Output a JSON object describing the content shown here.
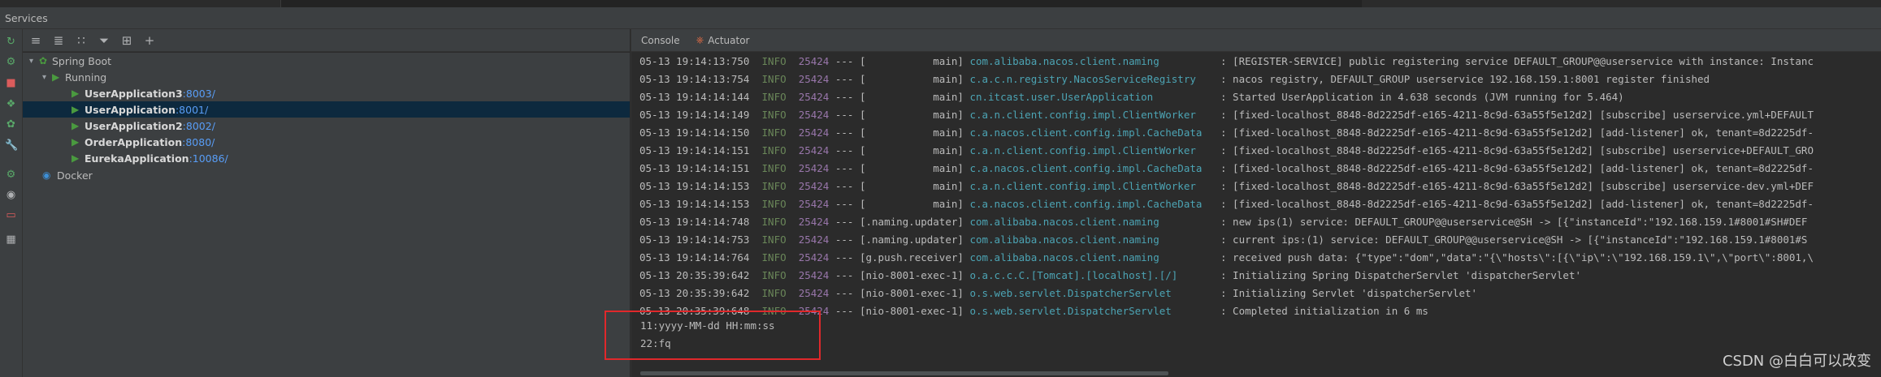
{
  "window": {
    "title": "Services"
  },
  "tree_toolbar": {
    "icons": [
      "expand-all-icon",
      "collapse-all-icon",
      "group-by-icon",
      "filter-icon",
      "new-tab-icon",
      "add-service-icon"
    ]
  },
  "left_toolbar": {
    "icons": [
      "rerun-icon",
      "debug-icon",
      "stop-icon",
      "deploy-icon",
      "spring-icon",
      "settings-icon",
      "restore-icon",
      "screenshot-icon",
      "exit-icon",
      "layout-icon"
    ]
  },
  "tree": {
    "spring_boot": "Spring Boot",
    "running": "Running",
    "apps": [
      {
        "name": "UserApplication3",
        "port": ":8003/"
      },
      {
        "name": "UserApplication",
        "port": ":8001/"
      },
      {
        "name": "UserApplication2",
        "port": ":8002/"
      },
      {
        "name": "OrderApplication",
        "port": ":8080/"
      },
      {
        "name": "EurekaApplication",
        "port": ":10086/"
      }
    ],
    "docker": "Docker"
  },
  "tabs": {
    "console": "Console",
    "actuator": "Actuator"
  },
  "log": [
    {
      "ts": "05-13 19:14:13:750",
      "lvl": "INFO",
      "pid": "25424",
      "sep": " --- [           main] ",
      "logger": "com.alibaba.nacos.client.naming         ",
      "msg": " : [REGISTER-SERVICE] public registering service DEFAULT_GROUP@@userservice with instance: Instanc"
    },
    {
      "ts": "05-13 19:14:13:754",
      "lvl": "INFO",
      "pid": "25424",
      "sep": " --- [           main] ",
      "logger": "c.a.c.n.registry.NacosServiceRegistry   ",
      "msg": " : nacos registry, DEFAULT_GROUP userservice 192.168.159.1:8001 register finished"
    },
    {
      "ts": "05-13 19:14:14:144",
      "lvl": "INFO",
      "pid": "25424",
      "sep": " --- [           main] ",
      "logger": "cn.itcast.user.UserApplication          ",
      "msg": " : Started UserApplication in 4.638 seconds (JVM running for 5.464)"
    },
    {
      "ts": "05-13 19:14:14:149",
      "lvl": "INFO",
      "pid": "25424",
      "sep": " --- [           main] ",
      "logger": "c.a.n.client.config.impl.ClientWorker   ",
      "msg": " : [fixed-localhost_8848-8d2225df-e165-4211-8c9d-63a55f5e12d2] [subscribe] userservice.yml+DEFAULT"
    },
    {
      "ts": "05-13 19:14:14:150",
      "lvl": "INFO",
      "pid": "25424",
      "sep": " --- [           main] ",
      "logger": "c.a.nacos.client.config.impl.CacheData  ",
      "msg": " : [fixed-localhost_8848-8d2225df-e165-4211-8c9d-63a55f5e12d2] [add-listener] ok, tenant=8d2225df-"
    },
    {
      "ts": "05-13 19:14:14:151",
      "lvl": "INFO",
      "pid": "25424",
      "sep": " --- [           main] ",
      "logger": "c.a.n.client.config.impl.ClientWorker   ",
      "msg": " : [fixed-localhost_8848-8d2225df-e165-4211-8c9d-63a55f5e12d2] [subscribe] userservice+DEFAULT_GRO"
    },
    {
      "ts": "05-13 19:14:14:151",
      "lvl": "INFO",
      "pid": "25424",
      "sep": " --- [           main] ",
      "logger": "c.a.nacos.client.config.impl.CacheData  ",
      "msg": " : [fixed-localhost_8848-8d2225df-e165-4211-8c9d-63a55f5e12d2] [add-listener] ok, tenant=8d2225df-"
    },
    {
      "ts": "05-13 19:14:14:153",
      "lvl": "INFO",
      "pid": "25424",
      "sep": " --- [           main] ",
      "logger": "c.a.n.client.config.impl.ClientWorker   ",
      "msg": " : [fixed-localhost_8848-8d2225df-e165-4211-8c9d-63a55f5e12d2] [subscribe] userservice-dev.yml+DEF"
    },
    {
      "ts": "05-13 19:14:14:153",
      "lvl": "INFO",
      "pid": "25424",
      "sep": " --- [           main] ",
      "logger": "c.a.nacos.client.config.impl.CacheData  ",
      "msg": " : [fixed-localhost_8848-8d2225df-e165-4211-8c9d-63a55f5e12d2] [add-listener] ok, tenant=8d2225df-"
    },
    {
      "ts": "05-13 19:14:14:748",
      "lvl": "INFO",
      "pid": "25424",
      "sep": " --- [.naming.updater] ",
      "logger": "com.alibaba.nacos.client.naming         ",
      "msg": " : new ips(1) service: DEFAULT_GROUP@@userservice@SH -> [{\"instanceId\":\"192.168.159.1#8001#SH#DEF"
    },
    {
      "ts": "05-13 19:14:14:753",
      "lvl": "INFO",
      "pid": "25424",
      "sep": " --- [.naming.updater] ",
      "logger": "com.alibaba.nacos.client.naming         ",
      "msg": " : current ips:(1) service: DEFAULT_GROUP@@userservice@SH -> [{\"instanceId\":\"192.168.159.1#8001#S"
    },
    {
      "ts": "05-13 19:14:14:764",
      "lvl": "INFO",
      "pid": "25424",
      "sep": " --- [g.push.receiver] ",
      "logger": "com.alibaba.nacos.client.naming         ",
      "msg": " : received push data: {\"type\":\"dom\",\"data\":\"{\\\"hosts\\\":[{\\\"ip\\\":\\\"192.168.159.1\\\",\\\"port\\\":8001,\\"
    },
    {
      "ts": "05-13 20:35:39:642",
      "lvl": "INFO",
      "pid": "25424",
      "sep": " --- [nio-8001-exec-1] ",
      "logger": "o.a.c.c.C.[Tomcat].[localhost].[/]      ",
      "msg": " : Initializing Spring DispatcherServlet 'dispatcherServlet'"
    },
    {
      "ts": "05-13 20:35:39:642",
      "lvl": "INFO",
      "pid": "25424",
      "sep": " --- [nio-8001-exec-1] ",
      "logger": "o.s.web.servlet.DispatcherServlet       ",
      "msg": " : Initializing Servlet 'dispatcherServlet'"
    },
    {
      "ts": "05-13 20:35:39:648",
      "lvl": "INFO",
      "pid": "25424",
      "sep": " --- [nio-8001-exec-1] ",
      "logger": "o.s.web.servlet.DispatcherServlet       ",
      "msg": " : Completed initialization in 6 ms"
    }
  ],
  "output_lines": [
    "11:yyyy-MM-dd HH:mm:ss",
    "22:fq"
  ],
  "watermark": "CSDN @白白可以改变"
}
